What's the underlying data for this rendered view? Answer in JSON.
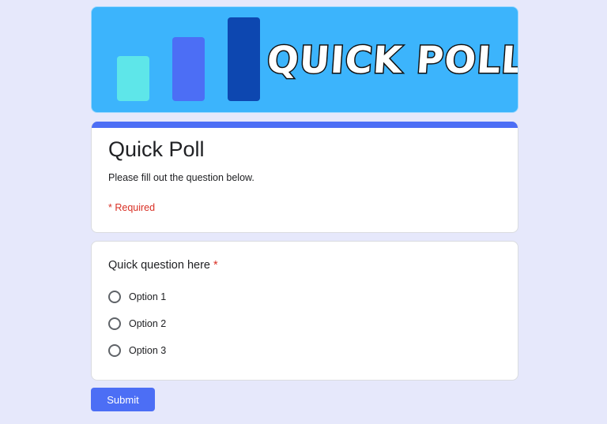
{
  "banner": {
    "title": "QUICK POLL",
    "colors": {
      "background": "#3cb4fc",
      "bar1": "#5ee6e9",
      "bar2": "#4c6ef5",
      "bar3": "#0d47b0"
    }
  },
  "form": {
    "title": "Quick Poll",
    "description": "Please fill out the question below.",
    "required_note": "* Required",
    "accent_color": "#4c6ef5"
  },
  "question": {
    "text": "Quick question here",
    "required_marker": "*",
    "options": [
      {
        "label": "Option 1",
        "selected": false
      },
      {
        "label": "Option 2",
        "selected": false
      },
      {
        "label": "Option 3",
        "selected": false
      }
    ]
  },
  "actions": {
    "submit_label": "Submit"
  }
}
